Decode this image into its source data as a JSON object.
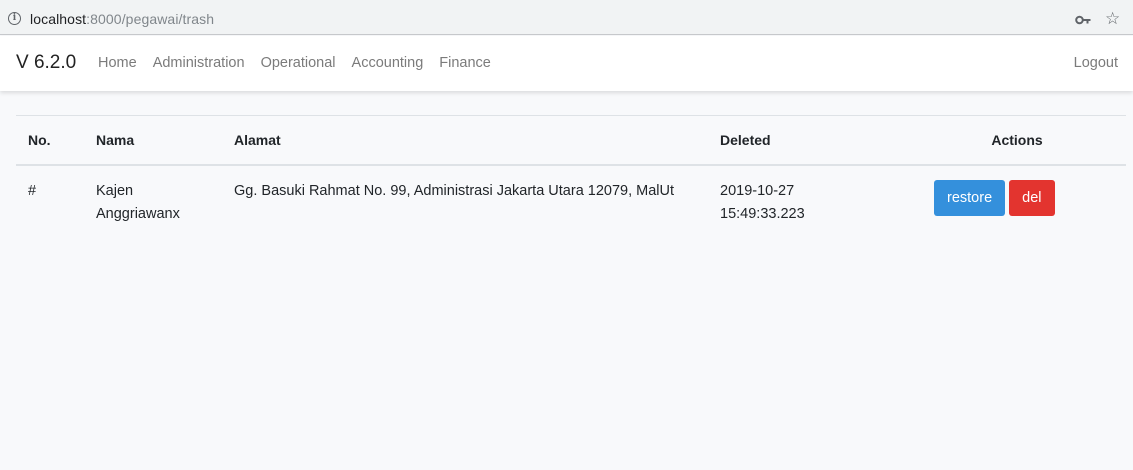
{
  "browser": {
    "url_host": "localhost",
    "url_rest": ":8000/pegawai/trash"
  },
  "navbar": {
    "brand": "V 6.2.0",
    "links": [
      "Home",
      "Administration",
      "Operational",
      "Accounting",
      "Finance"
    ],
    "logout": "Logout"
  },
  "table": {
    "headers": {
      "no": "No.",
      "nama": "Nama",
      "alamat": "Alamat",
      "deleted": "Deleted",
      "actions": "Actions"
    },
    "rows": [
      {
        "no": "#",
        "nama_line1": "Kajen",
        "nama_line2": "Anggriawanx",
        "alamat": "Gg. Basuki Rahmat No. 99, Administrasi Jakarta Utara 12079, MalUt",
        "deleted_date": "2019-10-27",
        "deleted_time": "15:49:33.223",
        "restore_label": "restore",
        "del_label": "del"
      }
    ]
  },
  "colors": {
    "restore": "#3490dc",
    "del": "#e3342f"
  }
}
